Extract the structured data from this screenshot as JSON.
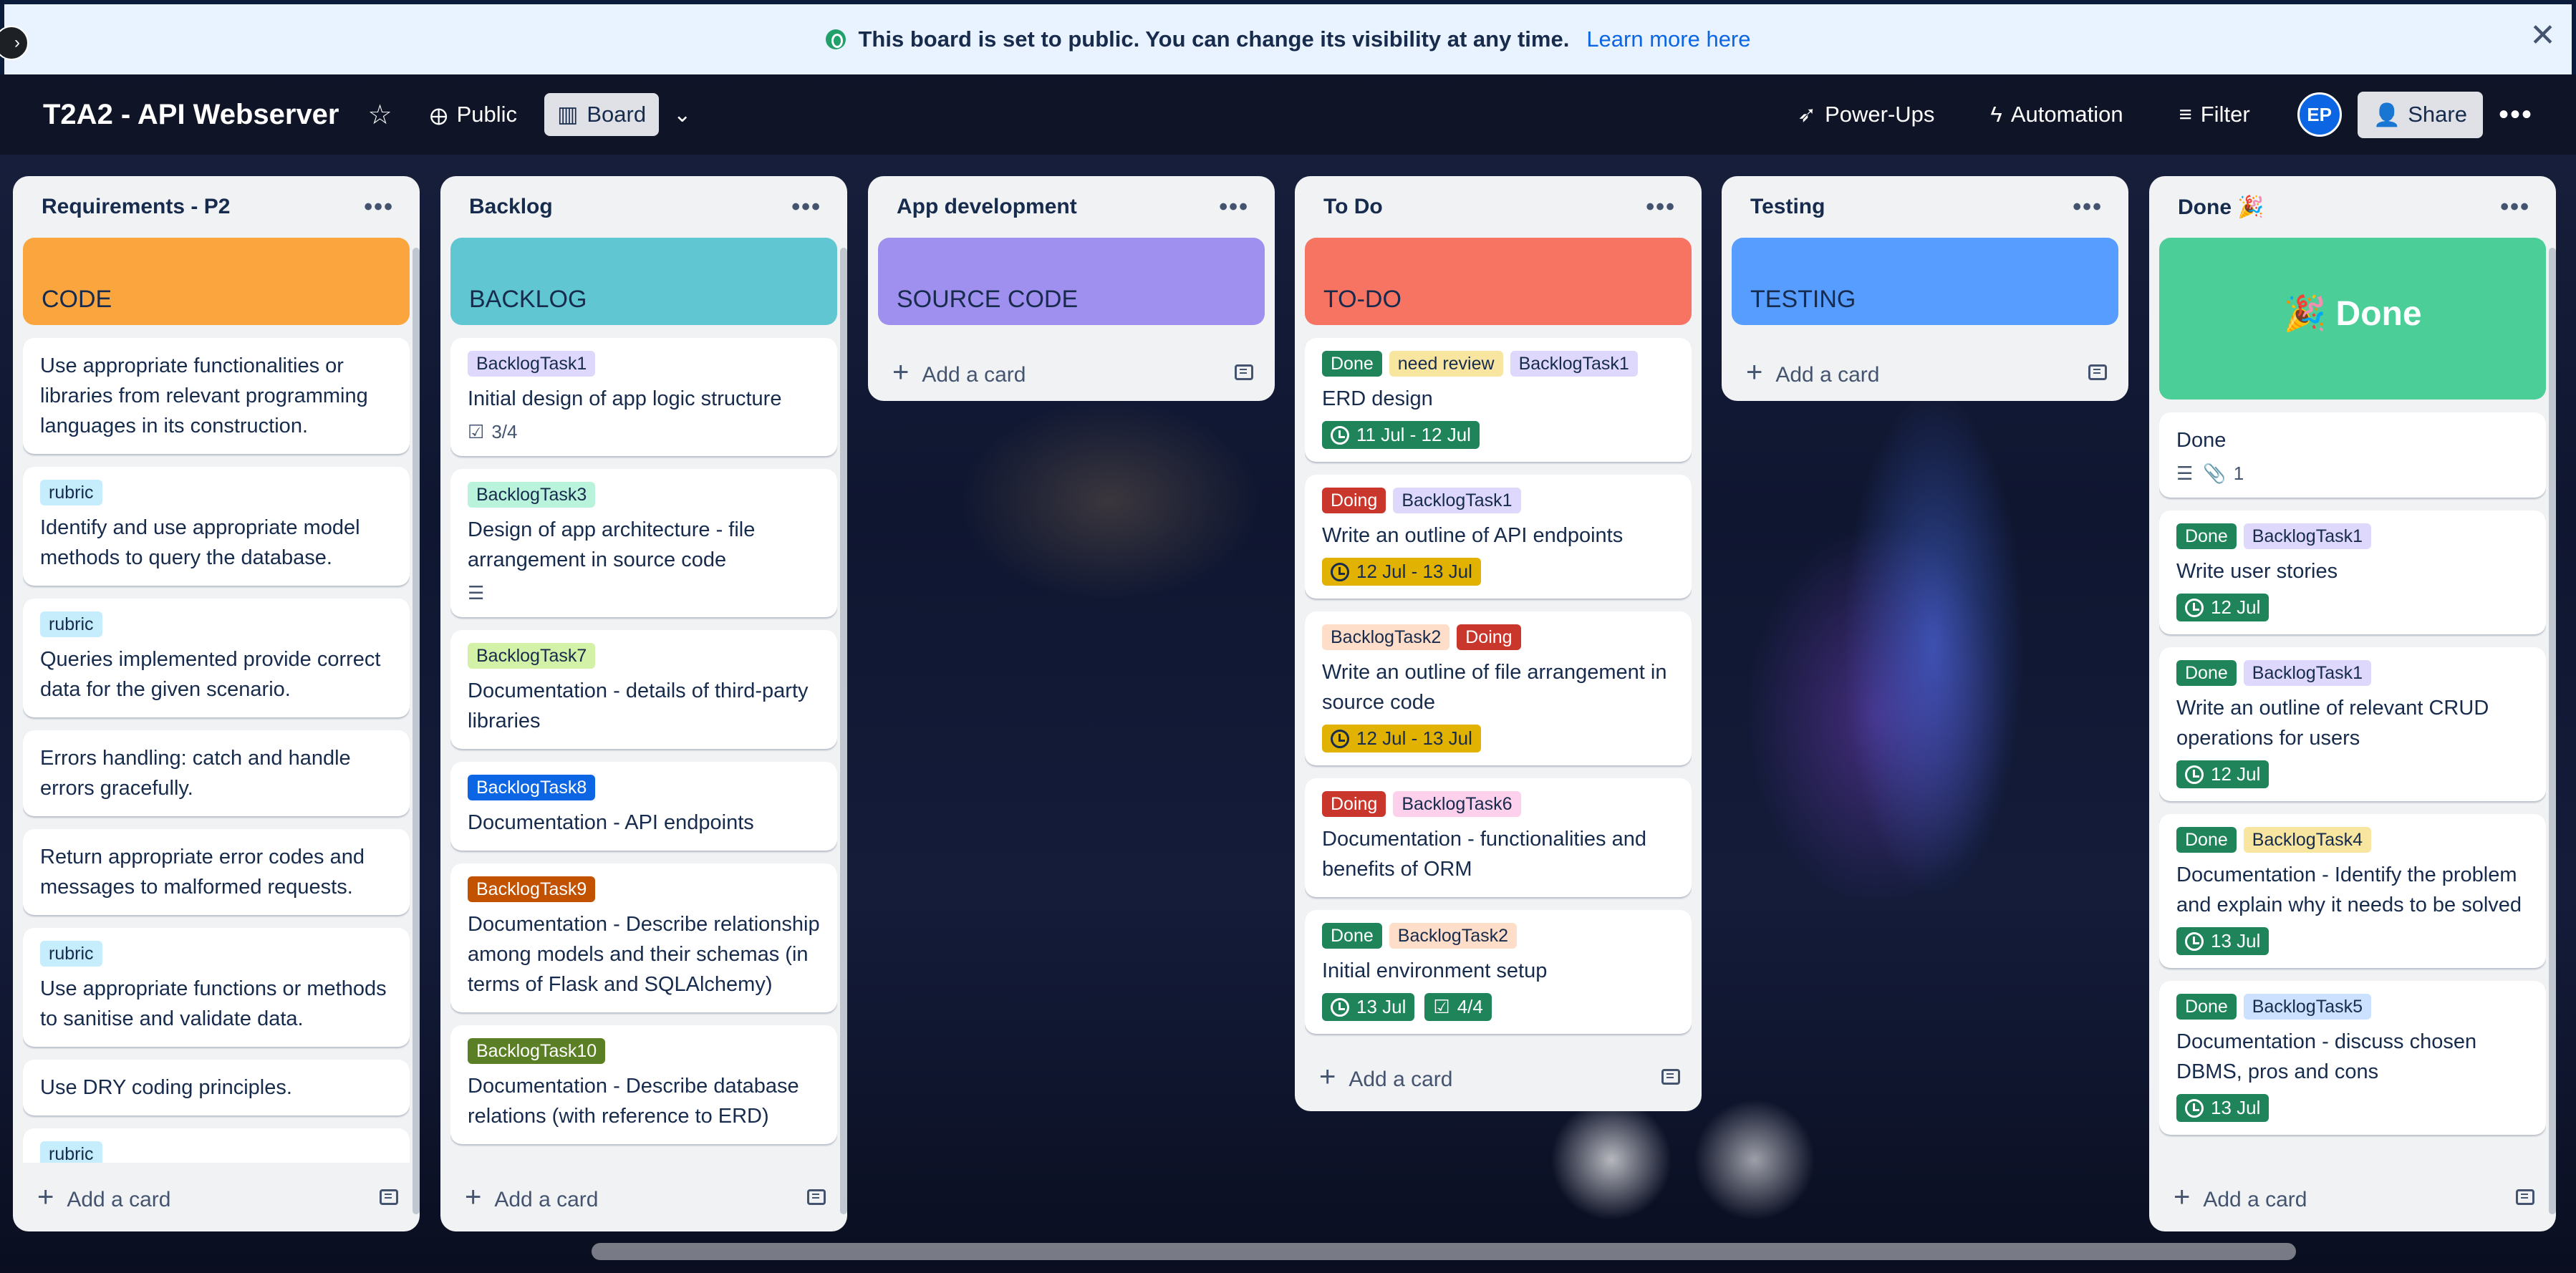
{
  "banner": {
    "text": "This board is set to public. You can change its visibility at any time.",
    "link": "Learn more here"
  },
  "header": {
    "title": "T2A2 - API Webserver",
    "visibility": "Public",
    "view": "Board",
    "powerups": "Power-Ups",
    "automation": "Automation",
    "filter": "Filter",
    "avatar": "EP",
    "share": "Share"
  },
  "lists": [
    {
      "title": "Requirements - P2",
      "cover": "CODE",
      "cover_color": "#faa53d",
      "add": "Add a card",
      "cards": [
        {
          "text": "Use appropriate functionalities or libraries from relevant programming languages in its construction."
        },
        {
          "labels": [
            {
              "t": "rubric",
              "c": "#c6edfb"
            }
          ],
          "text": "Identify and use appropriate model methods to query the database."
        },
        {
          "labels": [
            {
              "t": "rubric",
              "c": "#c6edfb"
            }
          ],
          "text": "Queries implemented provide correct data for the given scenario."
        },
        {
          "text": "Errors handling: catch and handle errors gracefully."
        },
        {
          "text": "Return appropriate error codes and messages to malformed requests."
        },
        {
          "labels": [
            {
              "t": "rubric",
              "c": "#c6edfb"
            }
          ],
          "text": "Use appropriate functions or methods to sanitise and validate data."
        },
        {
          "text": "Use DRY coding principles."
        },
        {
          "labels": [
            {
              "t": "rubric",
              "c": "#c6edfb"
            }
          ],
          "text": ""
        }
      ]
    },
    {
      "title": "Backlog",
      "cover": "BACKLOG",
      "cover_color": "#60c6d2",
      "add": "Add a card",
      "cards": [
        {
          "labels": [
            {
              "t": "BacklogTask1",
              "c": "#dfd8fd"
            }
          ],
          "text": "Initial design of app logic structure",
          "check": "3/4"
        },
        {
          "labels": [
            {
              "t": "BacklogTask3",
              "c": "#baf3db"
            }
          ],
          "text": "Design of app architecture - file arrangement in source code",
          "desc": true
        },
        {
          "labels": [
            {
              "t": "BacklogTask7",
              "c": "#d3f1a7"
            }
          ],
          "text": "Documentation - details of third-party libraries"
        },
        {
          "labels": [
            {
              "t": "BacklogTask8",
              "c": "#0c66e4",
              "fg": "#fff"
            }
          ],
          "text": "Documentation - API endpoints"
        },
        {
          "labels": [
            {
              "t": "BacklogTask9",
              "c": "#c25100",
              "fg": "#fff"
            }
          ],
          "text": "Documentation - Describe relationship among models and their schemas (in terms of Flask and SQLAlchemy)"
        },
        {
          "labels": [
            {
              "t": "BacklogTask10",
              "c": "#5b7f24",
              "fg": "#fff"
            }
          ],
          "text": "Documentation - Describe database relations (with reference to ERD)"
        }
      ]
    },
    {
      "title": "App development",
      "cover": "SOURCE CODE",
      "cover_color": "#9f8fef",
      "add": "Add a card",
      "cards": []
    },
    {
      "title": "To Do",
      "cover": "TO-DO",
      "cover_color": "#f87462",
      "add": "Add a card",
      "cards": [
        {
          "labels": [
            {
              "t": "Done",
              "c": "#1f845a",
              "fg": "#fff"
            },
            {
              "t": "need review",
              "c": "#f8e6a0"
            },
            {
              "t": "BacklogTask1",
              "c": "#dfd8fd"
            }
          ],
          "text": "ERD design",
          "date": "11 Jul - 12 Jul",
          "date_style": "green"
        },
        {
          "labels": [
            {
              "t": "Doing",
              "c": "#c9372c",
              "fg": "#fff"
            },
            {
              "t": "BacklogTask1",
              "c": "#dfd8fd"
            }
          ],
          "text": "Write an outline of API endpoints",
          "date": "12 Jul - 13 Jul",
          "date_style": "yellow"
        },
        {
          "labels": [
            {
              "t": "BacklogTask2",
              "c": "#fedec8"
            },
            {
              "t": "Doing",
              "c": "#c9372c",
              "fg": "#fff"
            }
          ],
          "text": "Write an outline of file arrangement in source code",
          "date": "12 Jul - 13 Jul",
          "date_style": "yellow"
        },
        {
          "labels": [
            {
              "t": "Doing",
              "c": "#c9372c",
              "fg": "#fff"
            },
            {
              "t": "BacklogTask6",
              "c": "#fdd0ec"
            }
          ],
          "text": "Documentation - functionalities and benefits of ORM"
        },
        {
          "labels": [
            {
              "t": "Done",
              "c": "#1f845a",
              "fg": "#fff"
            },
            {
              "t": "BacklogTask2",
              "c": "#fedec8"
            }
          ],
          "text": "Initial environment setup",
          "date": "13 Jul",
          "date_style": "green",
          "check": "4/4",
          "check_style": "green"
        }
      ]
    },
    {
      "title": "Testing",
      "cover": "TESTING",
      "cover_color": "#579dff",
      "add": "Add a card",
      "cards": []
    },
    {
      "title": "Done 🎉",
      "cover": "🎉 Done",
      "cover_color": "#4bce97",
      "add": "Add a card",
      "cards": [
        {
          "text": "Done",
          "desc": true,
          "attach": "1"
        },
        {
          "labels": [
            {
              "t": "Done",
              "c": "#1f845a",
              "fg": "#fff"
            },
            {
              "t": "BacklogTask1",
              "c": "#dfd8fd"
            }
          ],
          "text": "Write user stories",
          "date": "12 Jul",
          "date_style": "green"
        },
        {
          "labels": [
            {
              "t": "Done",
              "c": "#1f845a",
              "fg": "#fff"
            },
            {
              "t": "BacklogTask1",
              "c": "#dfd8fd"
            }
          ],
          "text": "Write an outline of relevant CRUD operations for users",
          "date": "12 Jul",
          "date_style": "green"
        },
        {
          "labels": [
            {
              "t": "Done",
              "c": "#1f845a",
              "fg": "#fff"
            },
            {
              "t": "BacklogTask4",
              "c": "#f8e6a0"
            }
          ],
          "text": "Documentation - Identify the problem and explain why it needs to be solved",
          "date": "13 Jul",
          "date_style": "green"
        },
        {
          "labels": [
            {
              "t": "Done",
              "c": "#1f845a",
              "fg": "#fff"
            },
            {
              "t": "BacklogTask5",
              "c": "#cce0ff"
            }
          ],
          "text": "Documentation - discuss chosen DBMS, pros and cons",
          "date": "13 Jul",
          "date_style": "green"
        }
      ]
    }
  ]
}
